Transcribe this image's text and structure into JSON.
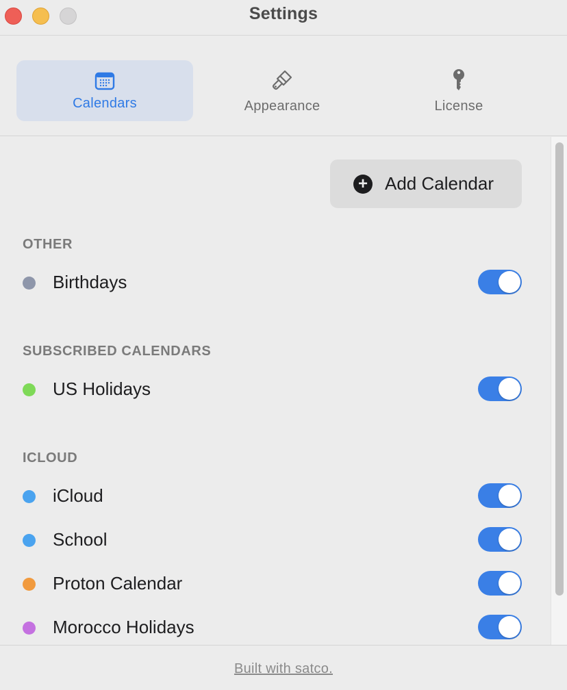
{
  "window": {
    "title": "Settings"
  },
  "tabs": [
    {
      "label": "Calendars",
      "icon": "calendar-icon",
      "active": true
    },
    {
      "label": "Appearance",
      "icon": "paintbrush-icon",
      "active": false
    },
    {
      "label": "License",
      "icon": "key-icon",
      "active": false
    }
  ],
  "add_button": {
    "label": "Add Calendar",
    "icon": "plus-circle-icon"
  },
  "sections": [
    {
      "title": "OTHER",
      "items": [
        {
          "name": "Birthdays",
          "color": "#8e96aa",
          "enabled": true
        }
      ]
    },
    {
      "title": "SUBSCRIBED CALENDARS",
      "items": [
        {
          "name": "US Holidays",
          "color": "#7ed957",
          "enabled": true
        }
      ]
    },
    {
      "title": "ICLOUD",
      "items": [
        {
          "name": "iCloud",
          "color": "#4aa3ef",
          "enabled": true
        },
        {
          "name": "School",
          "color": "#4aa3ef",
          "enabled": true
        },
        {
          "name": "Proton Calendar",
          "color": "#f19a3e",
          "enabled": true
        },
        {
          "name": "Morocco Holidays",
          "color": "#c471e0",
          "enabled": true
        }
      ]
    }
  ],
  "footer": {
    "link_label": "Built with satco."
  },
  "colors": {
    "accent": "#2f7ae5",
    "toggle_on": "#3a7fe6",
    "active_tab_bg": "#d8dfec"
  }
}
